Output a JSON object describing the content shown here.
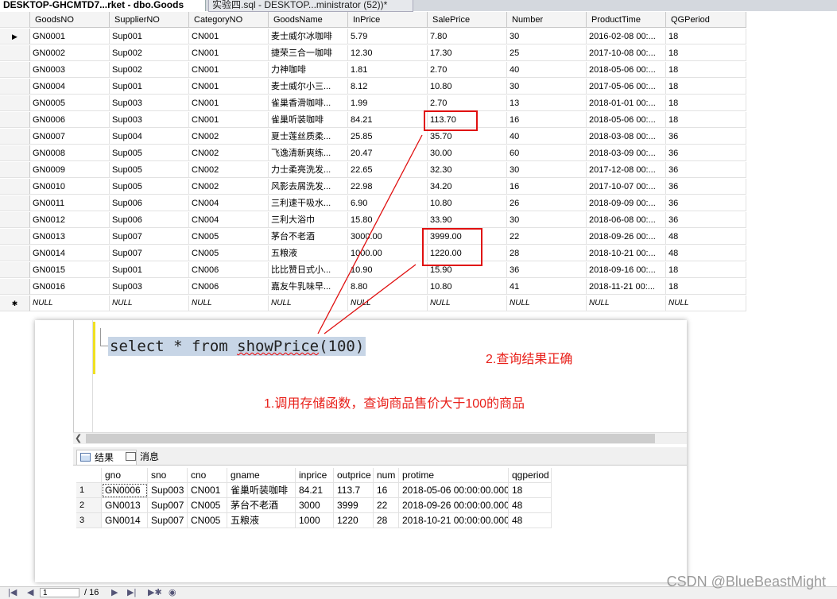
{
  "tabs": {
    "active": "DESKTOP-GHCMTD7...rket - dbo.Goods",
    "inactive": "实验四.sql - DESKTOP...ministrator (52))*"
  },
  "grid": {
    "columns": [
      "GoodsNO",
      "SupplierNO",
      "CategoryNO",
      "GoodsName",
      "InPrice",
      "SalePrice",
      "Number",
      "ProductTime",
      "QGPeriod"
    ],
    "rows": [
      [
        "GN0001",
        "Sup001",
        "CN001",
        "麦士威尔冰咖啡",
        "5.79",
        "7.80",
        "30",
        "2016-02-08 00:...",
        "18"
      ],
      [
        "GN0002",
        "Sup002",
        "CN001",
        "捷荣三合一咖啡",
        "12.30",
        "17.30",
        "25",
        "2017-10-08 00:...",
        "18"
      ],
      [
        "GN0003",
        "Sup002",
        "CN001",
        "力神咖啡",
        "1.81",
        "2.70",
        "40",
        "2018-05-06 00:...",
        "18"
      ],
      [
        "GN0004",
        "Sup001",
        "CN001",
        "麦士威尔小三...",
        "8.12",
        "10.80",
        "30",
        "2017-05-06 00:...",
        "18"
      ],
      [
        "GN0005",
        "Sup003",
        "CN001",
        "雀巢香滑咖啡...",
        "1.99",
        "2.70",
        "13",
        "2018-01-01 00:...",
        "18"
      ],
      [
        "GN0006",
        "Sup003",
        "CN001",
        "雀巢听装咖啡",
        "84.21",
        "113.70",
        "16",
        "2018-05-06 00:...",
        "18"
      ],
      [
        "GN0007",
        "Sup004",
        "CN002",
        "夏士莲丝质柔...",
        "25.85",
        "35.70",
        "40",
        "2018-03-08 00:...",
        "36"
      ],
      [
        "GN0008",
        "Sup005",
        "CN002",
        "飞逸清新爽练...",
        "20.47",
        "30.00",
        "60",
        "2018-03-09 00:...",
        "36"
      ],
      [
        "GN0009",
        "Sup005",
        "CN002",
        "力士柔亮洗发...",
        "22.65",
        "32.30",
        "30",
        "2017-12-08 00:...",
        "36"
      ],
      [
        "GN0010",
        "Sup005",
        "CN002",
        "风影去屑洗发...",
        "22.98",
        "34.20",
        "16",
        "2017-10-07 00:...",
        "36"
      ],
      [
        "GN0011",
        "Sup006",
        "CN004",
        "三利速干吸水...",
        "6.90",
        "10.80",
        "26",
        "2018-09-09 00:...",
        "36"
      ],
      [
        "GN0012",
        "Sup006",
        "CN004",
        "三利大浴巾",
        "15.80",
        "33.90",
        "30",
        "2018-06-08 00:...",
        "36"
      ],
      [
        "GN0013",
        "Sup007",
        "CN005",
        "茅台不老酒",
        "3000.00",
        "3999.00",
        "22",
        "2018-09-26 00:...",
        "48"
      ],
      [
        "GN0014",
        "Sup007",
        "CN005",
        "五粮液",
        "1000.00",
        "1220.00",
        "28",
        "2018-10-21 00:...",
        "48"
      ],
      [
        "GN0015",
        "Sup001",
        "CN006",
        "比比赞日式小...",
        "10.90",
        "15.90",
        "36",
        "2018-09-16 00:...",
        "18"
      ],
      [
        "GN0016",
        "Sup003",
        "CN006",
        "嘉友牛乳味早...",
        "8.80",
        "10.80",
        "41",
        "2018-11-21 00:...",
        "18"
      ]
    ],
    "null_label": "NULL",
    "current_row_marker": "▶",
    "new_row_marker": "✱"
  },
  "editor": {
    "sql_keyword": "select * from ",
    "sql_function": "showPrice",
    "sql_args": "(100)",
    "annotation_1": "1.调用存储函数，查询商品售价大于100的商品",
    "annotation_2": "2.查询结果正确",
    "annotation_color": "#e8201a"
  },
  "results": {
    "tab_results": "结果",
    "tab_messages": "消息",
    "columns": [
      "gno",
      "sno",
      "cno",
      "gname",
      "inprice",
      "outprice",
      "num",
      "protime",
      "qgperiod"
    ],
    "rows": [
      [
        "1",
        "GN0006",
        "Sup003",
        "CN001",
        "雀巢听装咖啡",
        "84.21",
        "113.7",
        "16",
        "2018-05-06 00:00:00.000",
        "18"
      ],
      [
        "2",
        "GN0013",
        "Sup007",
        "CN005",
        "茅台不老酒",
        "3000",
        "3999",
        "22",
        "2018-09-26 00:00:00.000",
        "48"
      ],
      [
        "3",
        "GN0014",
        "Sup007",
        "CN005",
        "五粮液",
        "1000",
        "1220",
        "28",
        "2018-10-21 00:00:00.000",
        "48"
      ]
    ]
  },
  "navbar": {
    "page_value": "1",
    "page_total": "/ 16"
  },
  "watermark": "CSDN @BlueBeastMight"
}
